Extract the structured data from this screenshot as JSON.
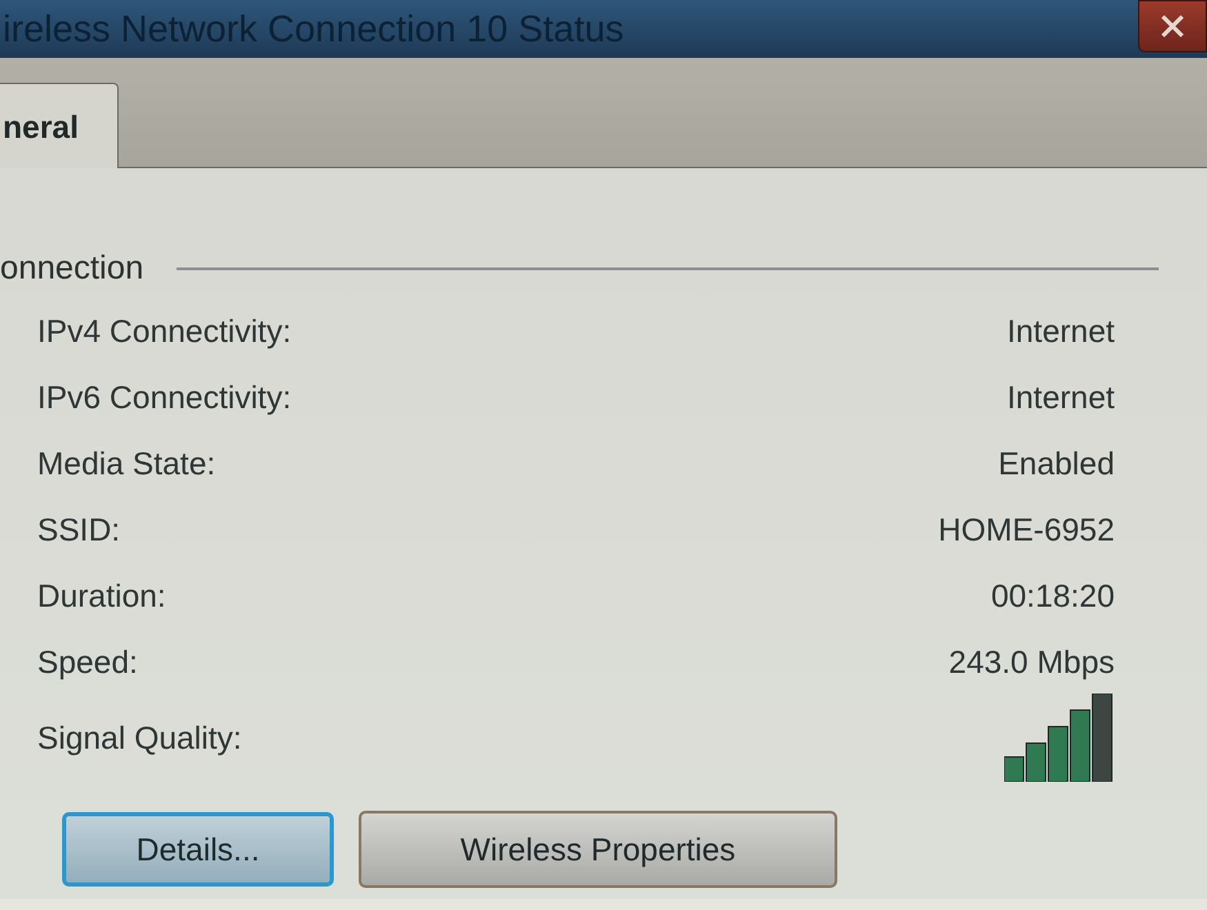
{
  "window": {
    "title": "ireless Network Connection 10 Status"
  },
  "tabs": [
    {
      "label": "neral",
      "selected": true
    }
  ],
  "group": {
    "title": "onnection"
  },
  "rows": [
    {
      "kind": "text",
      "label": "IPv4 Connectivity:",
      "value": "Internet"
    },
    {
      "kind": "text",
      "label": "IPv6 Connectivity:",
      "value": "Internet"
    },
    {
      "kind": "text",
      "label": "Media State:",
      "value": "Enabled"
    },
    {
      "kind": "text",
      "label": "SSID:",
      "value": "HOME-6952"
    },
    {
      "kind": "text",
      "label": "Duration:",
      "value": "00:18:20"
    },
    {
      "kind": "text",
      "label": "Speed:",
      "value": "243.0 Mbps"
    },
    {
      "kind": "signal",
      "label": "Signal Quality:"
    }
  ],
  "buttons": [
    {
      "label": "Details...",
      "focused": true
    },
    {
      "label": "Wireless Properties",
      "focused": false
    }
  ]
}
